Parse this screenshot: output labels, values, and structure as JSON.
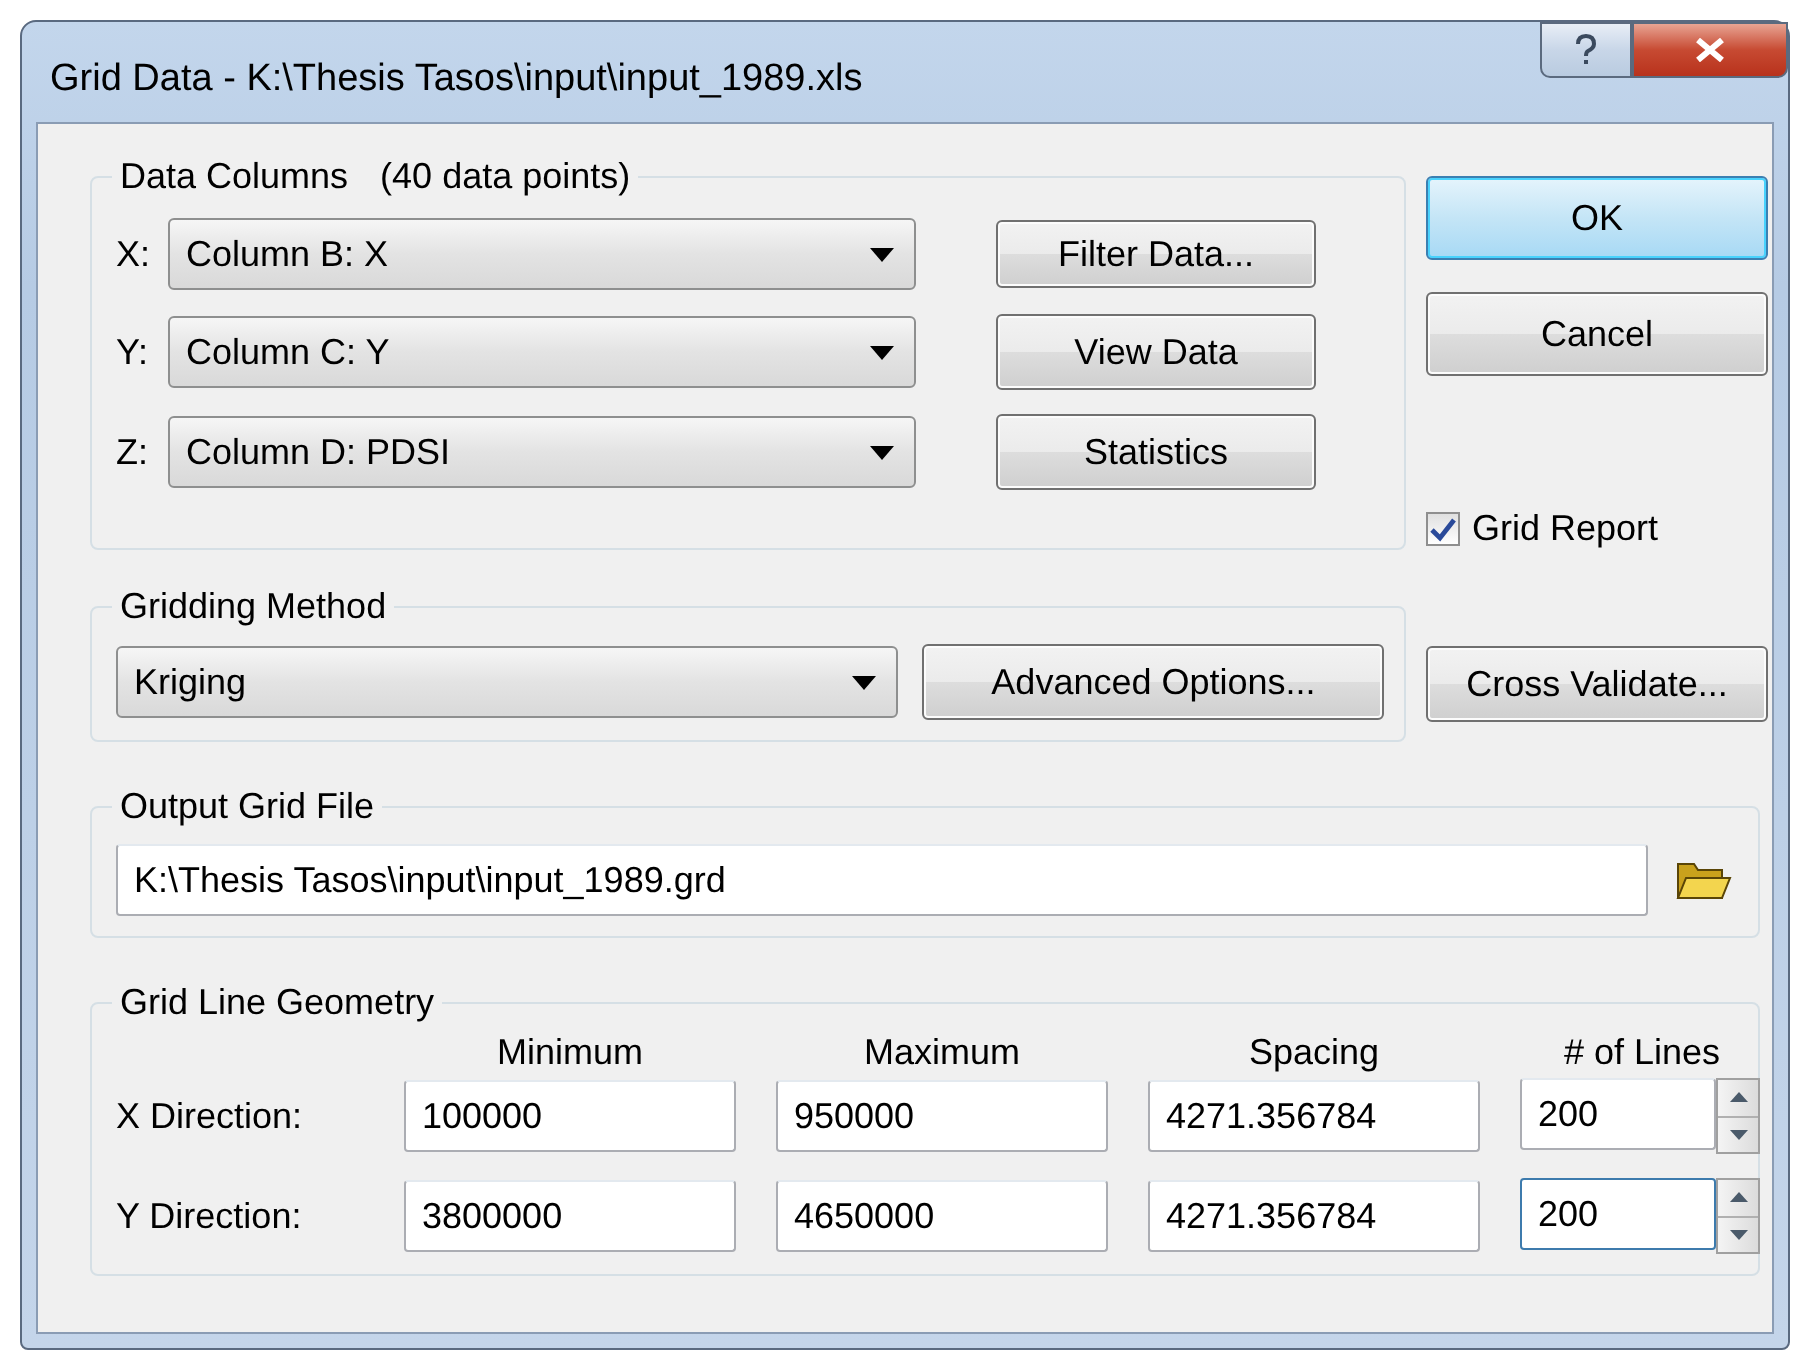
{
  "window": {
    "title": "Grid Data - K:\\Thesis Tasos\\input\\input_1989.xls"
  },
  "data_columns": {
    "title": "Data Columns",
    "note": "(40 data points)",
    "rows": [
      {
        "axis": "X:",
        "value": "Column B:  X",
        "button": "Filter Data..."
      },
      {
        "axis": "Y:",
        "value": "Column C:  Y",
        "button": "View Data"
      },
      {
        "axis": "Z:",
        "value": "Column D:  PDSI",
        "button": "Statistics"
      }
    ]
  },
  "dialog_buttons": [
    {
      "label": "OK",
      "default": true
    },
    {
      "label": "Cancel",
      "default": false
    }
  ],
  "grid_report": {
    "label": "Grid Report",
    "checked": true
  },
  "gridding_method": {
    "title": "Gridding Method",
    "value": "Kriging",
    "button": "Advanced Options..."
  },
  "cross_validate": {
    "label": "Cross Validate..."
  },
  "output_grid_file": {
    "title": "Output Grid File",
    "value": "K:\\Thesis Tasos\\input\\input_1989.grd"
  },
  "grid_line_geometry": {
    "title": "Grid Line Geometry",
    "columns": [
      "Minimum",
      "Maximum",
      "Spacing",
      "# of Lines"
    ],
    "rows": [
      {
        "label": "X Direction:",
        "minimum": "100000",
        "maximum": "950000",
        "spacing": "4271.356784",
        "lines": "200",
        "focused": false
      },
      {
        "label": "Y Direction:",
        "minimum": "3800000",
        "maximum": "4650000",
        "spacing": "4271.356784",
        "lines": "200",
        "focused": true
      }
    ]
  }
}
